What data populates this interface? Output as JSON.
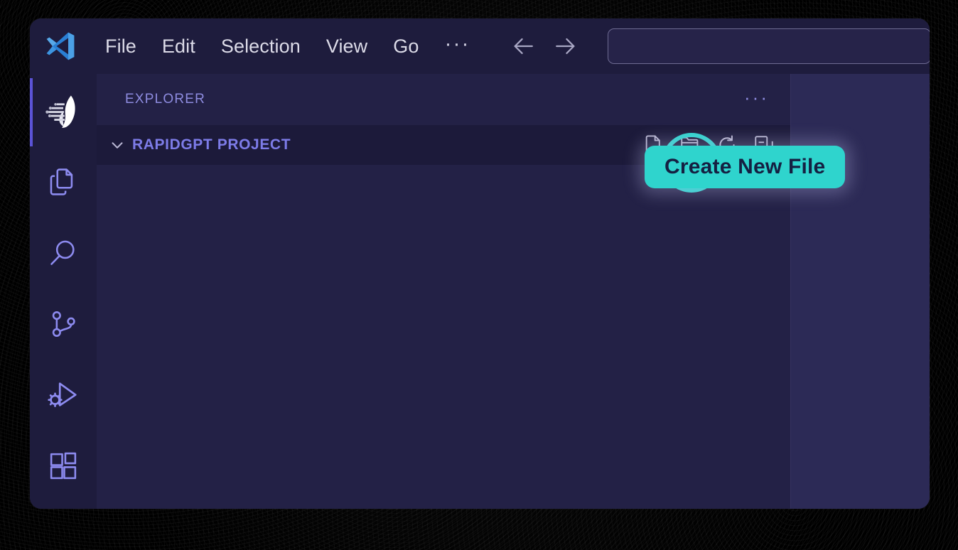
{
  "window": {
    "app_name": "Visual Studio Code",
    "logo_icon": "vscode-logo-icon"
  },
  "titlebar": {
    "menus": [
      {
        "label": "File",
        "name": "menu-file"
      },
      {
        "label": "Edit",
        "name": "menu-edit"
      },
      {
        "label": "Selection",
        "name": "menu-selection"
      },
      {
        "label": "View",
        "name": "menu-view"
      },
      {
        "label": "Go",
        "name": "menu-go"
      },
      {
        "label": "···",
        "name": "menu-more"
      }
    ],
    "nav": {
      "back_icon": "arrow-left-icon",
      "forward_icon": "arrow-right-icon"
    },
    "search": {
      "value": "",
      "placeholder": ""
    }
  },
  "activitybar": {
    "items": [
      {
        "label": "RapidGPT",
        "icon": "rapidgpt-logo-icon",
        "name": "activitybar-item-rapidgpt",
        "active": true
      },
      {
        "label": "Explorer",
        "icon": "files-icon",
        "name": "activitybar-item-explorer",
        "active": false
      },
      {
        "label": "Search",
        "icon": "search-icon",
        "name": "activitybar-item-search",
        "active": false
      },
      {
        "label": "Source Control",
        "icon": "source-control-icon",
        "name": "activitybar-item-source-control",
        "active": false
      },
      {
        "label": "Run and Debug",
        "icon": "run-debug-icon",
        "name": "activitybar-item-run-debug",
        "active": false
      },
      {
        "label": "Extensions",
        "icon": "extensions-icon",
        "name": "activitybar-item-extensions",
        "active": false
      }
    ]
  },
  "explorer": {
    "title": "EXPLORER",
    "more_actions": "···",
    "folder": {
      "name": "RAPIDGPT PROJECT",
      "expanded": true,
      "chevron_icon": "chevron-down-icon"
    },
    "actions": [
      {
        "label": "New File",
        "icon": "new-file-icon",
        "name": "new-file-button",
        "highlighted": true
      },
      {
        "label": "New Folder",
        "icon": "new-folder-icon",
        "name": "new-folder-button",
        "highlighted": false
      },
      {
        "label": "Refresh Explorer",
        "icon": "refresh-icon",
        "name": "refresh-explorer-button",
        "highlighted": false
      },
      {
        "label": "Collapse Folders in Explorer",
        "icon": "collapse-all-icon",
        "name": "collapse-all-button",
        "highlighted": false
      }
    ],
    "tree_items": []
  },
  "tooltip": {
    "text": "Create New File",
    "background": "#2fd4cd",
    "text_color": "#152042"
  },
  "colors": {
    "accent_teal": "#2fd4cd",
    "titlebar_bg": "#1e1c3d",
    "activitybar_bg": "#1e1c3d",
    "explorer_bg": "#232146",
    "folder_row_bg": "#1c1a3a",
    "editor_bg": "#2c2a56",
    "icon_purple": "#8d8bf0",
    "active_indicator": "#5b53d6"
  }
}
